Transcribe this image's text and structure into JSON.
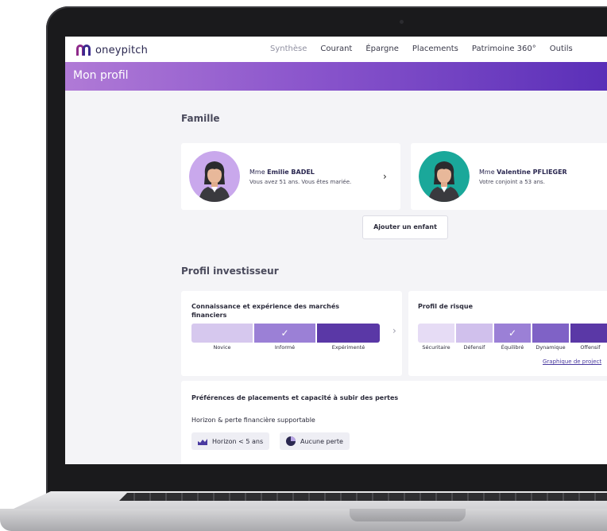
{
  "app": {
    "logo_text": "oneypitch"
  },
  "nav": {
    "items": [
      {
        "label": "Synthèse",
        "active": true
      },
      {
        "label": "Courant"
      },
      {
        "label": "Épargne"
      },
      {
        "label": "Placements"
      },
      {
        "label": "Patrimoine 360°"
      },
      {
        "label": "Outils"
      }
    ]
  },
  "banner": {
    "title": "Mon profil"
  },
  "famille": {
    "title": "Famille",
    "persons": [
      {
        "prefix": "Mme ",
        "name": "Emilie BADEL",
        "desc": "Vous avez 51 ans. Vous êtes mariée.",
        "avatar_color": "#c9a8ec"
      },
      {
        "prefix": "Mme ",
        "name": "Valentine PFLIEGER",
        "desc": "Votre conjoint a 53 ans.",
        "avatar_color": "#1aa89a"
      }
    ],
    "add_child_label": "Ajouter un enfant"
  },
  "investisseur": {
    "title": "Profil investisseur",
    "knowledge": {
      "title": "Connaissance et expérience des marchés financiers",
      "levels": [
        "Novice",
        "Informé",
        "Expérimenté"
      ],
      "selected": "Informé",
      "colors": [
        "#d6c8ee",
        "#9b80d6",
        "#5a38a6"
      ]
    },
    "risk": {
      "title": "Profil de risque",
      "levels": [
        "Sécuritaire",
        "Défensif",
        "Équilibré",
        "Dynamique",
        "Offensif"
      ],
      "selected": "Équilibré",
      "colors": [
        "#e6dcf5",
        "#d0c0ec",
        "#9b80d6",
        "#7f62c6",
        "#5a38a6"
      ],
      "link_label": "Graphique de project"
    }
  },
  "preferences": {
    "title": "Préférences de placements et capacité à subir des pertes",
    "subtitle": "Horizon & perte financière supportable",
    "chips": [
      {
        "label": "Horizon < 5 ans",
        "icon": "area-chart-icon"
      },
      {
        "label": "Aucune perte",
        "icon": "pie-chart-icon"
      }
    ]
  }
}
